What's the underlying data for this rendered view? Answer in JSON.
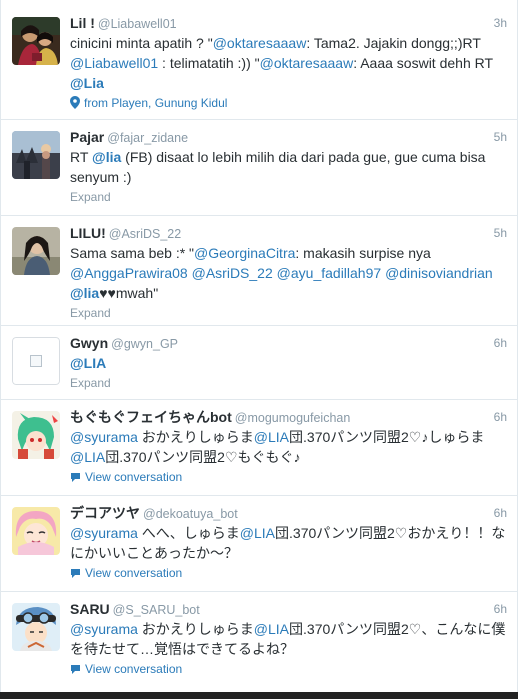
{
  "colors": {
    "link": "#2b7bb9",
    "meta": "#8899a6",
    "text": "#292f33",
    "divider": "#e1e8ed"
  },
  "tweets": [
    {
      "fullname": "Lil !",
      "username": "@Liabawell01",
      "time": "3h",
      "avatar": "photo-avatar-couple",
      "parts": [
        {
          "t": "cinicini minta apatih ? \"",
          "c": ""
        },
        {
          "t": "@oktaresaaaw",
          "c": "mention"
        },
        {
          "t": ": Tama2. Jajakin dongg;;)RT ",
          "c": ""
        },
        {
          "t": "@Liabawell01",
          "c": "mention"
        },
        {
          "t": " : telimatatih :)) \"",
          "c": ""
        },
        {
          "t": "@oktaresaaaw",
          "c": "mention"
        },
        {
          "t": ": Aaaa soswit dehh RT ",
          "c": ""
        },
        {
          "t": "@Lia",
          "c": "mention-bold"
        }
      ],
      "footer": {
        "type": "location",
        "icon": "map-pin-icon",
        "text": "from Playen, Gunung Kidul"
      }
    },
    {
      "fullname": "Pajar",
      "username": "@fajar_zidane",
      "time": "5h",
      "avatar": "photo-avatar-sunset",
      "parts": [
        {
          "t": "RT ",
          "c": ""
        },
        {
          "t": "@lia",
          "c": "mention-bold"
        },
        {
          "t": " (FB) disaat lo lebih milih dia dari pada gue, gue cuma bisa senyum :)",
          "c": ""
        }
      ],
      "footer": {
        "type": "expand",
        "icon": "",
        "text": "Expand"
      }
    },
    {
      "fullname": "LILU!",
      "username": "@AsriDS_22",
      "time": "5h",
      "avatar": "photo-avatar-girl",
      "parts": [
        {
          "t": "Sama sama beb :* \"",
          "c": ""
        },
        {
          "t": "@GeorginaCitra",
          "c": "mention"
        },
        {
          "t": ": makasih surpise nya ",
          "c": ""
        },
        {
          "t": "@AnggaPrawira08",
          "c": "mention"
        },
        {
          "t": " ",
          "c": ""
        },
        {
          "t": "@AsriDS_22",
          "c": "mention"
        },
        {
          "t": " ",
          "c": ""
        },
        {
          "t": "@ayu_fadillah97",
          "c": "mention"
        },
        {
          "t": " ",
          "c": ""
        },
        {
          "t": "@dinisoviandrian",
          "c": "mention"
        },
        {
          "t": " ",
          "c": ""
        },
        {
          "t": "@lia",
          "c": "mention-bold"
        },
        {
          "t": "♥♥mwah\"",
          "c": ""
        }
      ],
      "footer": {
        "type": "expand",
        "icon": "",
        "text": "Expand"
      }
    },
    {
      "fullname": "Gwyn",
      "username": "@gwyn_GP",
      "time": "6h",
      "avatar": "broken-image-avatar",
      "parts": [
        {
          "t": "@LIA",
          "c": "mention-bold"
        }
      ],
      "footer": {
        "type": "expand",
        "icon": "",
        "text": "Expand"
      }
    },
    {
      "fullname": "もぐもぐフェイちゃんbot",
      "username": "@mogumogufeichan",
      "time": "6h",
      "avatar": "anime-avatar-green-hair",
      "parts": [
        {
          "t": "@syurama",
          "c": "mention"
        },
        {
          "t": " おかえりしゅらま",
          "c": ""
        },
        {
          "t": "@LIA",
          "c": "mention"
        },
        {
          "t": "団.370パンツ同盟2♡♪しゅらま",
          "c": ""
        },
        {
          "t": "@LIA",
          "c": "mention"
        },
        {
          "t": "団.370パンツ同盟2♡もぐもぐ♪",
          "c": ""
        }
      ],
      "footer": {
        "type": "conversation",
        "icon": "speech-bubble-icon",
        "text": "View conversation"
      }
    },
    {
      "fullname": "デコアツヤ",
      "username": "@dekoatuya_bot",
      "time": "6h",
      "avatar": "anime-avatar-pink-hair",
      "parts": [
        {
          "t": "@syurama",
          "c": "mention"
        },
        {
          "t": " へへ、しゅらま",
          "c": ""
        },
        {
          "t": "@LIA",
          "c": "mention"
        },
        {
          "t": "団.370パンツ同盟2♡おかえり！！なにかいいことあったか〜？",
          "c": ""
        }
      ],
      "footer": {
        "type": "conversation",
        "icon": "speech-bubble-icon",
        "text": "View conversation"
      }
    },
    {
      "fullname": "SARU",
      "username": "@S_SARU_bot",
      "time": "6h",
      "avatar": "anime-avatar-goggles",
      "parts": [
        {
          "t": "@syurama",
          "c": "mention"
        },
        {
          "t": " おかえりしゅらま",
          "c": ""
        },
        {
          "t": "@LIA",
          "c": "mention"
        },
        {
          "t": "団.370パンツ同盟2♡、こんなに僕を待たせて…覚悟はできてるよね？",
          "c": ""
        }
      ],
      "footer": {
        "type": "conversation",
        "icon": "speech-bubble-icon",
        "text": "View conversation"
      }
    }
  ]
}
